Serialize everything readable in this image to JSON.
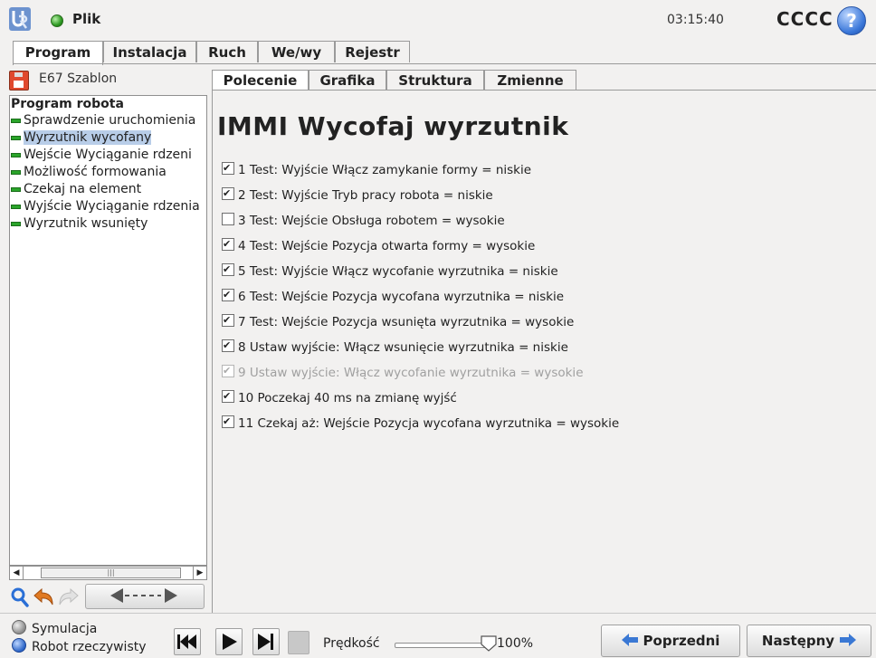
{
  "header": {
    "menu_label": "Plik",
    "time": "03:15:40",
    "user": "CCCC",
    "help_glyph": "?"
  },
  "main_tabs": [
    {
      "label": "Program",
      "active": true
    },
    {
      "label": "Instalacja",
      "active": false
    },
    {
      "label": "Ruch",
      "active": false
    },
    {
      "label": "We/wy",
      "active": false
    },
    {
      "label": "Rejestr",
      "active": false
    }
  ],
  "file": {
    "name": "E67 Szablon"
  },
  "tree": {
    "root": "Program robota",
    "items": [
      {
        "label": "Sprawdzenie uruchomienia",
        "selected": false
      },
      {
        "label": "Wyrzutnik wycofany",
        "selected": true
      },
      {
        "label": "Wejście Wyciąganie rdzeni",
        "selected": false
      },
      {
        "label": "Możliwość formowania",
        "selected": false
      },
      {
        "label": "Czekaj na element",
        "selected": false
      },
      {
        "label": "Wyjście Wyciąganie rdzenia",
        "selected": false
      },
      {
        "label": "Wyrzutnik wsunięty",
        "selected": false
      }
    ],
    "status_color": "#2aa42a",
    "selection_color": "#b8cde8"
  },
  "toolbar": {
    "search_icon": "search-icon",
    "undo_icon": "undo-icon",
    "redo_icon": "redo-icon",
    "move_icon": "move-arrows-icon"
  },
  "sub_tabs": [
    {
      "label": "Polecenie",
      "active": true
    },
    {
      "label": "Grafika",
      "active": false
    },
    {
      "label": "Struktura",
      "active": false
    },
    {
      "label": "Zmienne",
      "active": false
    }
  ],
  "command": {
    "title": "IMMI Wycofaj wyrzutnik",
    "lines": [
      {
        "text": "1 Test: Wyjście Włącz zamykanie formy = niskie",
        "checked": true,
        "enabled": true
      },
      {
        "text": "2 Test: Wyjście Tryb pracy robota = niskie",
        "checked": true,
        "enabled": true
      },
      {
        "text": "3 Test: Wejście Obsługa robotem = wysokie",
        "checked": false,
        "enabled": true
      },
      {
        "text": "4 Test: Wejście Pozycja otwarta formy = wysokie",
        "checked": true,
        "enabled": true
      },
      {
        "text": "5 Test: Wyjście Włącz wycofanie wyrzutnika = niskie",
        "checked": true,
        "enabled": true
      },
      {
        "text": "6 Test: Wejście Pozycja wycofana wyrzutnika = niskie",
        "checked": true,
        "enabled": true
      },
      {
        "text": "7 Test: Wejście Pozycja wsunięta wyrzutnika = wysokie",
        "checked": true,
        "enabled": true
      },
      {
        "text": "8 Ustaw wyjście: Włącz wsunięcie wyrzutnika = niskie",
        "checked": true,
        "enabled": true
      },
      {
        "text": "9 Ustaw wyjście: Włącz wycofanie wyrzutnika = wysokie",
        "checked": true,
        "enabled": false
      },
      {
        "text": "10 Poczekaj 40 ms na zmianę wyjść",
        "checked": true,
        "enabled": true
      },
      {
        "text": "11 Czekaj aż: Wejście Pozycja wycofana wyrzutnika = wysokie",
        "checked": true,
        "enabled": true
      }
    ]
  },
  "footer": {
    "mode_simulation": "Symulacja",
    "mode_real": "Robot rzeczywisty",
    "speed_label": "Prędkość",
    "speed_value": "100%",
    "speed_fraction": 1.0,
    "prev_label": "Poprzedni",
    "next_label": "Następny",
    "arrow_color": "#3a78d4"
  }
}
